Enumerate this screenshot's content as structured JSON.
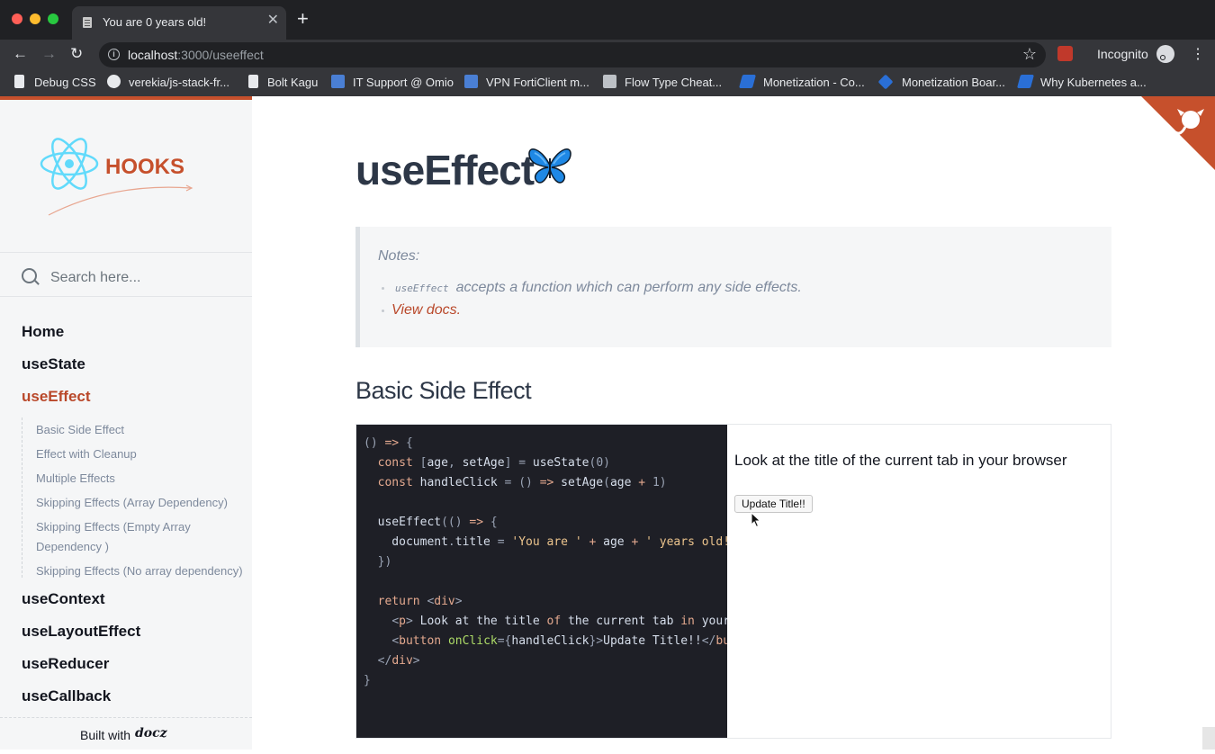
{
  "browser": {
    "tab_title": "You are 0 years old!",
    "url_host": "localhost",
    "url_path": ":3000/useeffect",
    "profile_label": "Incognito",
    "bookmarks": [
      "Debug CSS",
      "verekia/js-stack-fr...",
      "Bolt Kagu",
      "IT Support @ Omio",
      "VPN FortiClient m...",
      "Flow Type Cheat...",
      "Monetization - Co...",
      "Monetization Boar...",
      "Why Kubernetes a..."
    ]
  },
  "sidebar": {
    "logo_text": "HOOKS",
    "search_placeholder": "Search here...",
    "nav": [
      "Home",
      "useState",
      "useEffect",
      "useContext",
      "useLayoutEffect",
      "useReducer",
      "useCallback"
    ],
    "active": "useEffect",
    "sub_items": [
      "Basic Side Effect",
      "Effect with Cleanup",
      "Multiple Effects",
      "Skipping Effects (Array Dependency)",
      "Skipping Effects (Empty Array Dependency )",
      "Skipping Effects (No array dependency)"
    ],
    "built_with": "Built with",
    "built_with_brand": "docz"
  },
  "main": {
    "title": "useEffect",
    "notes_title": "Notes:",
    "note_code": "useEffect",
    "note_text": "accepts a function which can perform any side effects.",
    "note_link": "View docs.",
    "section_title": "Basic Side Effect",
    "preview_text": "Look at the title of the current tab in your browser",
    "preview_button": "Update Title!!"
  },
  "colors": {
    "accent": "#b9482a",
    "chrome_dark": "#202124",
    "chrome_mid": "#35363a",
    "code_bg": "#1e1f26"
  }
}
